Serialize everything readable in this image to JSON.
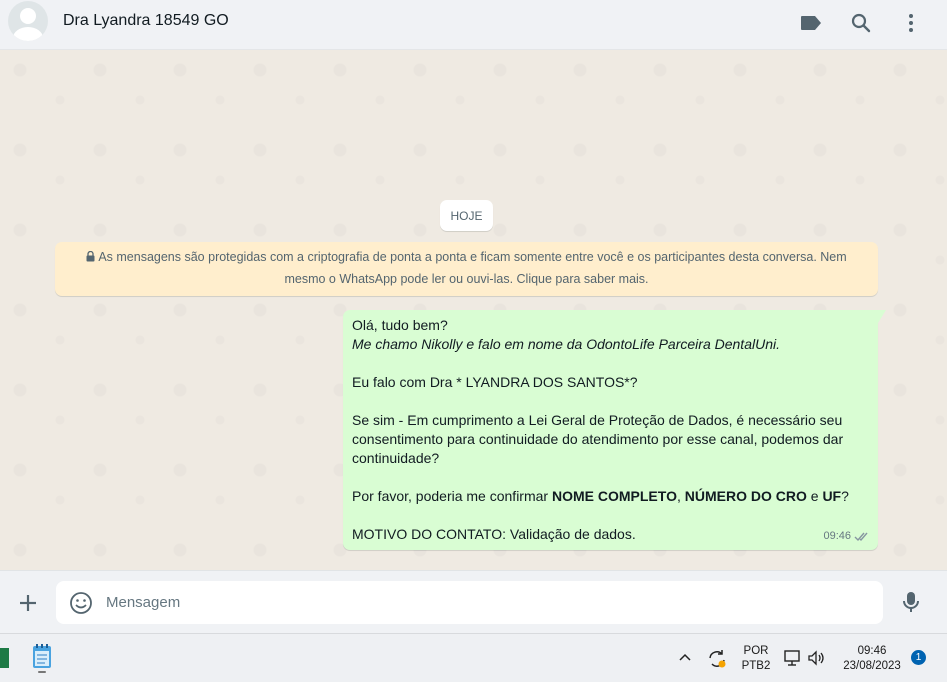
{
  "header": {
    "contact_name": "Dra Lyandra 18549 GO",
    "icons": [
      "label-icon",
      "search-icon",
      "menu-icon"
    ]
  },
  "chat": {
    "date_chip": "HOJE",
    "encryption_notice": "As mensagens são protegidas com a criptografia de ponta a ponta e ficam somente entre você e os participantes desta conversa. Nem mesmo o WhatsApp pode ler ou ouvi-las. Clique para saber mais.",
    "message": {
      "line1": "Olá, tudo bem?",
      "line2": "Me chamo Nikolly e falo em nome da OdontoLife Parceira DentalUni.",
      "line3": "Eu falo com Dra * LYANDRA DOS SANTOS*?",
      "line4": "Se sim - Em cumprimento a Lei Geral de Proteção de Dados, é necessário seu consentimento para continuidade do atendimento por esse canal, podemos dar continuidade?",
      "line5_pre": "Por favor, poderia me confirmar ",
      "line5_b1": "NOME COMPLETO",
      "line5_sep1": ", ",
      "line5_b2": "NÚMERO DO CRO",
      "line5_sep2": " e ",
      "line5_b3": "UF",
      "line5_end": "?",
      "line6": "MOTIVO DO CONTATO: Validação de dados.",
      "time": "09:46",
      "status": "read",
      "status_color": "#8696a0"
    }
  },
  "composer": {
    "placeholder": "Mensagem"
  },
  "taskbar": {
    "language_line1": "POR",
    "language_line2": "PTB2",
    "clock_time": "09:46",
    "clock_date": "23/08/2023",
    "notification_count": "1"
  },
  "colors": {
    "outgoing_bubble": "#d9fdd3",
    "chat_background": "#efeae2",
    "encryption_bg": "#ffeecd",
    "header_bg": "#f0f2f5",
    "accent_blue": "#0063b1"
  }
}
